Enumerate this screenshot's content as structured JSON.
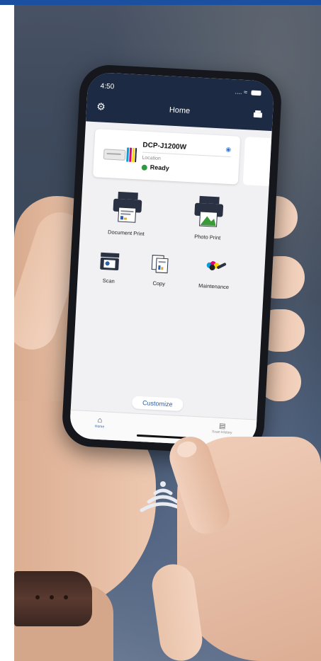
{
  "status_bar": {
    "time": "4:50",
    "signal": "...."
  },
  "header": {
    "title": "Home"
  },
  "printer_card": {
    "model": "DCP-J1200W",
    "location_label": "Location",
    "status": "Ready"
  },
  "features": {
    "document_print": "Document Print",
    "photo_print": "Photo Print",
    "scan": "Scan",
    "copy": "Copy",
    "maintenance": "Maintenance"
  },
  "customize_label": "Customize",
  "bottom_nav": {
    "home": "Home",
    "scan_history": "Scan History"
  },
  "colors": {
    "brand_bar": "#1b4fa0",
    "header": "#1c2a44",
    "status_ready": "#2f9a44",
    "accent": "#2b5fa8"
  },
  "icons": {
    "settings": "gear-icon",
    "printer": "printer-icon",
    "wifi": "wifi-icon",
    "nfc": "nfc-waves-icon"
  }
}
